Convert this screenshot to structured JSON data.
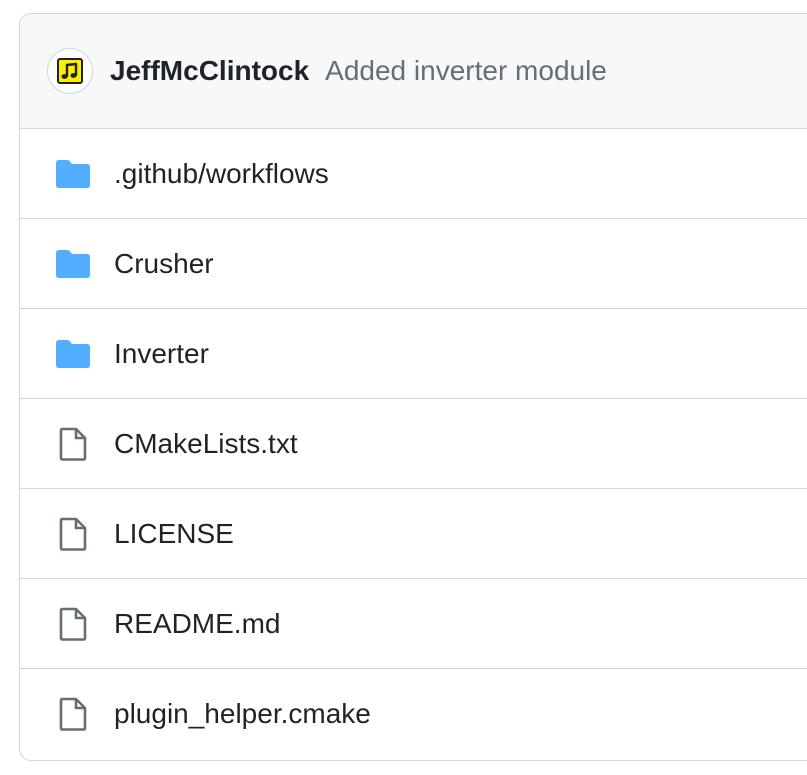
{
  "commit": {
    "author": "JeffMcClintock",
    "message": "Added inverter module",
    "avatar_icon": "music-note-avatar-icon"
  },
  "colors": {
    "folder": "#54aeff",
    "file_icon": "#656d76",
    "avatar_fill": "#ffee00",
    "header_bg": "#f6f8fa",
    "border": "#d0d7de"
  },
  "files": [
    {
      "name": ".github/workflows",
      "type": "folder",
      "icon": "folder-icon"
    },
    {
      "name": "Crusher",
      "type": "folder",
      "icon": "folder-icon"
    },
    {
      "name": "Inverter",
      "type": "folder",
      "icon": "folder-icon"
    },
    {
      "name": "CMakeLists.txt",
      "type": "file",
      "icon": "file-icon"
    },
    {
      "name": "LICENSE",
      "type": "file",
      "icon": "file-icon"
    },
    {
      "name": "README.md",
      "type": "file",
      "icon": "file-icon"
    },
    {
      "name": "plugin_helper.cmake",
      "type": "file",
      "icon": "file-icon"
    }
  ]
}
